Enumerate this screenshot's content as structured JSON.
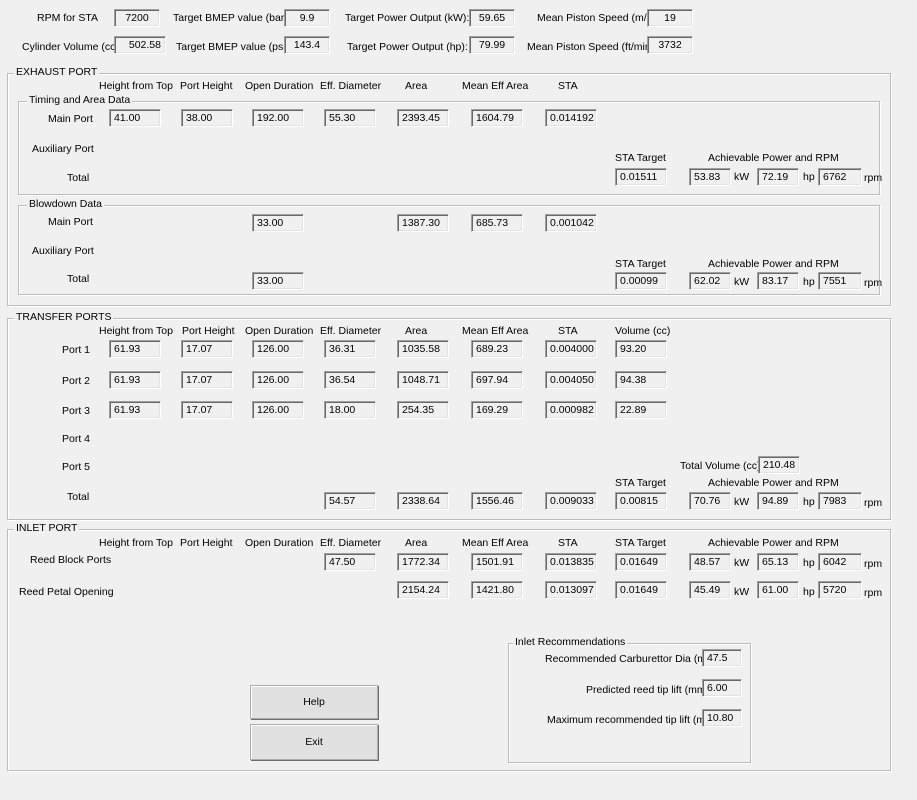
{
  "top": {
    "rpm_label": "RPM for STA",
    "rpm": "7200",
    "bmep_bar_label": "Target BMEP value (bar):",
    "bmep_bar": "9.9",
    "power_kw_label": "Target Power Output (kW):",
    "power_kw": "59.65",
    "piston_ms_label": "Mean Piston Speed (m/s):",
    "piston_ms": "19",
    "cyl_vol_label": "Cylinder Volume (cc):",
    "cyl_vol": "502.58",
    "bmep_psi_label": "Target BMEP value (psi):",
    "bmep_psi": "143.4",
    "power_hp_label": "Target Power Output (hp):",
    "power_hp": "79.99",
    "piston_ftmin_label": "Mean Piston Speed (ft/min):",
    "piston_ftmin": "3732"
  },
  "units": {
    "kw": "kW",
    "hp": "hp",
    "rpm": "rpm"
  },
  "exhaust": {
    "title": "EXHAUST PORT",
    "headers": [
      "Height from Top",
      "Port Height",
      "Open Duration",
      "Eff. Diameter",
      "Area",
      "Mean Eff Area",
      "STA"
    ],
    "timing_title": "Timing and Area Data",
    "main_label": "Main Port",
    "main": [
      "41.00",
      "38.00",
      "192.00",
      "55.30",
      "2393.45",
      "1604.79",
      "0.014192"
    ],
    "aux_label": "Auxiliary Port",
    "total_label": "Total",
    "sta_target_label": "STA Target",
    "ach_label": "Achievable Power and RPM",
    "sta_target": "0.01511",
    "ach_kw": "53.83",
    "ach_hp": "72.19",
    "ach_rpm": "6762",
    "blowdown_title": "Blowdown Data",
    "bd_main_label": "Main Port",
    "bd_main_open": "33.00",
    "bd_main_area": "1387.30",
    "bd_main_mean": "685.73",
    "bd_main_sta": "0.001042",
    "bd_aux_label": "Auxiliary Port",
    "bd_total_label": "Total",
    "bd_total_open": "33.00",
    "bd_sta_target_label": "STA Target",
    "bd_ach_label": "Achievable Power and RPM",
    "bd_sta_target": "0.00099",
    "bd_ach_kw": "62.02",
    "bd_ach_hp": "83.17",
    "bd_ach_rpm": "7551"
  },
  "transfer": {
    "title": "TRANSFER PORTS",
    "headers": [
      "Height from Top",
      "Port Height",
      "Open Duration",
      "Eff. Diameter",
      "Area",
      "Mean Eff Area",
      "STA",
      "Volume (cc)"
    ],
    "ports": [
      {
        "label": "Port 1",
        "values": [
          "61.93",
          "17.07",
          "126.00",
          "36.31",
          "1035.58",
          "689.23",
          "0.004000",
          "93.20"
        ]
      },
      {
        "label": "Port 2",
        "values": [
          "61.93",
          "17.07",
          "126.00",
          "36.54",
          "1048.71",
          "697.94",
          "0.004050",
          "94.38"
        ]
      },
      {
        "label": "Port 3",
        "values": [
          "61.93",
          "17.07",
          "126.00",
          "18.00",
          "254.35",
          "169.29",
          "0.000982",
          "22.89"
        ]
      }
    ],
    "port4_label": "Port 4",
    "port5_label": "Port 5",
    "total_volume_label": "Total Volume (cc)",
    "total_volume": "210.48",
    "total_label": "Total",
    "total_eff_dia": "54.57",
    "total_area": "2338.64",
    "total_mean": "1556.46",
    "total_sta": "0.009033",
    "sta_target_label": "STA Target",
    "ach_label": "Achievable Power and RPM",
    "sta_target": "0.00815",
    "ach_kw": "70.76",
    "ach_hp": "94.89",
    "ach_rpm": "7983"
  },
  "inlet": {
    "title": "INLET PORT",
    "headers": [
      "Height from Top",
      "Port Height",
      "Open Duration",
      "Eff. Diameter",
      "Area",
      "Mean Eff Area",
      "STA",
      "STA Target",
      "Achievable Power and RPM"
    ],
    "reed_block_label": "Reed Block Ports",
    "reed_block": {
      "eff_dia": "47.50",
      "area": "1772.34",
      "mean": "1501.91",
      "sta": "0.013835",
      "sta_target": "0.01649",
      "kw": "48.57",
      "hp": "65.13",
      "rpm": "6042"
    },
    "reed_petal_label": "Reed Petal Opening",
    "reed_petal": {
      "area": "2154.24",
      "mean": "1421.80",
      "sta": "0.013097",
      "sta_target": "0.01649",
      "kw": "45.49",
      "hp": "61.00",
      "rpm": "5720"
    },
    "rec_title": "Inlet Recommendations",
    "carb_label": "Recommended Carburettor Dia (mm):",
    "carb": "47.5",
    "tip_label": "Predicted reed tip lift (mm):",
    "tip": "6.00",
    "max_tip_label": "Maximum recommended tip lift (mm):",
    "max_tip": "10.80"
  },
  "buttons": {
    "help": "Help",
    "exit": "Exit"
  }
}
